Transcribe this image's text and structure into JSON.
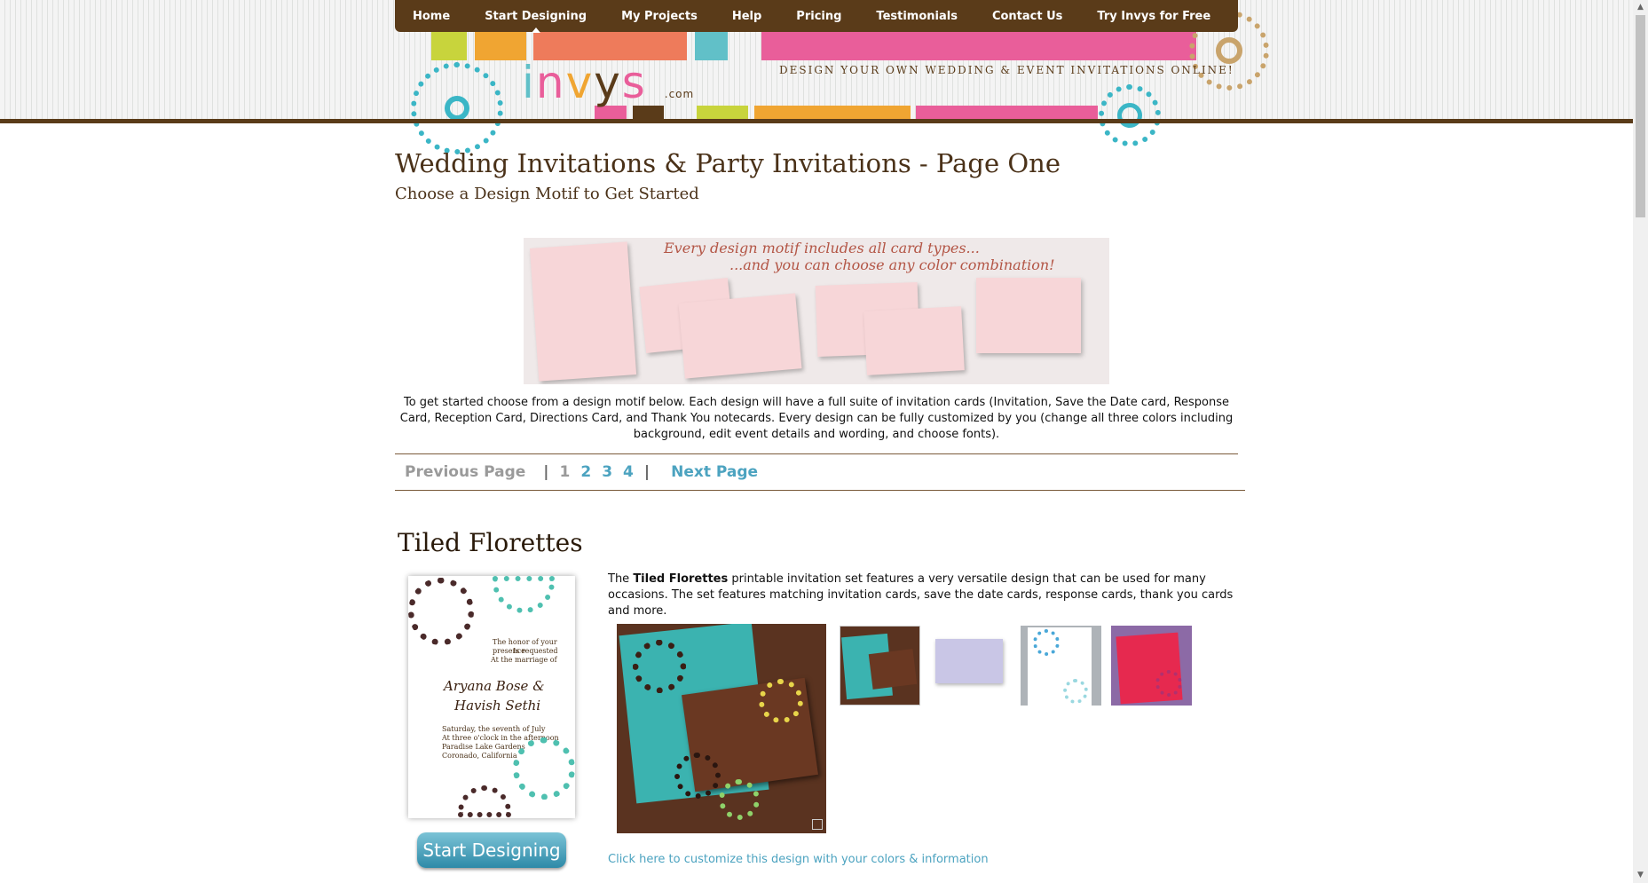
{
  "nav": {
    "items": [
      "Home",
      "Start Designing",
      "My Projects",
      "Help",
      "Pricing",
      "Testimonials",
      "Contact Us",
      "Try Invys for Free"
    ],
    "active_index": 1
  },
  "header": {
    "logo_text": "invys",
    "logo_suffix": ".com",
    "tagline": "Design your own wedding & event invitations online!"
  },
  "main": {
    "title": "Wedding Invitations & Party Invitations - Page One",
    "subtitle": "Choose a Design Motif to Get Started",
    "banner": {
      "line1": "Every design motif includes all card types...",
      "line2": "...and you can choose any color combination!"
    },
    "intro": "To get started choose from a design motif below. Each design will have a full suite of invitation cards (Invitation, Save the Date card, Response Card, Reception Card, Directions Card, and Thank You notecards. Every design can be fully customized by you (change all three colors including background, edit event details and wording, and choose fonts).",
    "pager": {
      "previous": "Previous Page",
      "separator": "|",
      "pages": [
        "1",
        "2",
        "3",
        "4"
      ],
      "next": "Next Page"
    },
    "motif": {
      "title": "Tiled Florettes",
      "desc_prefix": "The ",
      "desc_bold": "Tiled Florettes",
      "desc_rest": " printable invitation set features a very versatile design that can be used for many occasions. The set features matching invitation cards, save the date cards, response cards, thank you cards and more.",
      "preview_card": {
        "line1": "The honor of your presence",
        "line2": "Is requested",
        "line3": "At the marriage of",
        "name1": "Aryana Bose &",
        "name2": "Havish Sethi",
        "date1": "Saturday, the seventh of July",
        "date2": "At three o'clock in the afternoon",
        "date3": "Paradise Lake Gardens",
        "date4": "Coronado, California"
      },
      "start_button": "Start Designing",
      "customize_link": "Click here to customize this design with your colors & information"
    }
  },
  "colors": {
    "brand_brown": "#5a3b19",
    "link_teal": "#4ca3c0",
    "accent_pink": "#e95e9a",
    "accent_orange": "#f0a532",
    "accent_lime": "#c8d43c",
    "accent_coral": "#ee7b5b",
    "accent_teal": "#61c0c8"
  }
}
